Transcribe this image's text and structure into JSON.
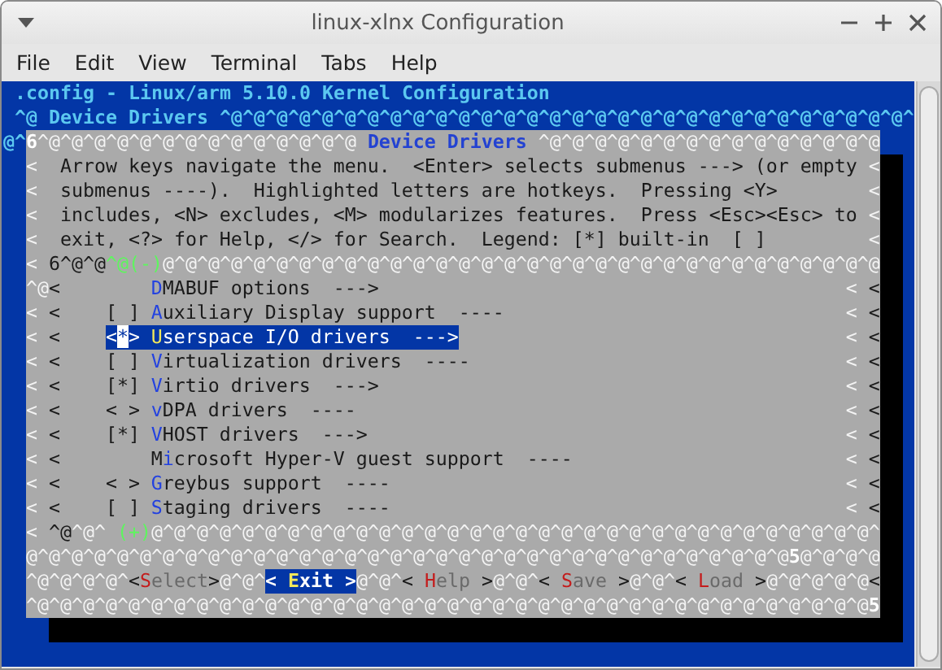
{
  "window": {
    "title": "linux-xlnx Configuration"
  },
  "menu_bar": [
    "File",
    "Edit",
    "View",
    "Terminal",
    "Tabs",
    "Help"
  ],
  "terminal": {
    "header": [
      ".config - Linux/arm 5.10.0 Kernel Configuration",
      "^@ Device Drivers ^@^@^@^@^@^@^@^@^@^@^@^@^@^@^@^@^@^@^@^@^@^@^@^@^@^@^@^@^@^@^"
    ],
    "left_margin": "@^",
    "dialog_rows": [
      {
        "kind": "line",
        "segments": [
          {
            "kind": "bright",
            "text": "6"
          },
          {
            "kind": "fill",
            "text": "^@^@^@^@^@^@^@^@^@^@^@^@^@^@"
          },
          {
            "kind": "title",
            "text": "Device Drivers"
          },
          {
            "kind": "fill",
            "text": "^@^@^@^@^@^@^@^@^@^@^@^@^@^@^@"
          }
        ]
      },
      {
        "kind": "help",
        "left": "<",
        "text": "Arrow keys navigate the menu.  <Enter> selects submenus ---> (or empty",
        "right": "<"
      },
      {
        "kind": "help",
        "left": "<",
        "text": "submenus ----).  Highlighted letters are hotkeys.  Pressing <Y>",
        "right": "<"
      },
      {
        "kind": "help",
        "left": "<",
        "text": "includes, <N> excludes, <M> modularizes features.  Press <Esc><Esc> to",
        "right": "<"
      },
      {
        "kind": "help",
        "left": "<",
        "text": "exit, <?> for Help, </> for Search.  Legend: [*] built-in  [ ]",
        "right": "<"
      },
      {
        "kind": "line",
        "segments": [
          {
            "kind": "fill",
            "text": "<"
          },
          {
            "kind": "dark",
            "text": " 6^@^@"
          },
          {
            "kind": "green",
            "text": "^@(-)"
          },
          {
            "kind": "fill",
            "text": "@^@^@^@^@^@^@^@^@^@^@^@^@^@^@^@^@^@^@^@^@^@^@^@^@^@^@^@^@^@^@^@"
          }
        ]
      },
      {
        "kind": "item",
        "edge": "^@",
        "mark": "<",
        "hotkey": "D",
        "rest": "MABUF options",
        "suffix": "--->",
        "right_edge": "<",
        "right_mark": "<",
        "selected": false
      },
      {
        "kind": "item",
        "edge": "<",
        "mark": "<",
        "bracket": "[ ]",
        "hotkey": "A",
        "rest": "uxiliary Display support",
        "suffix": "----",
        "right_edge": "<",
        "right_mark": "<",
        "selected": false
      },
      {
        "kind": "item",
        "edge": "<",
        "mark": "<",
        "bracket": "<*>",
        "hotkey": "U",
        "rest": "serspace I/O drivers",
        "suffix": "--->",
        "right_edge": "<",
        "right_mark": "<",
        "selected": true
      },
      {
        "kind": "item",
        "edge": "<",
        "mark": "<",
        "bracket": "[ ]",
        "hotkey": "V",
        "rest": "irtualization drivers",
        "suffix": "----",
        "right_edge": "<",
        "right_mark": "<",
        "selected": false
      },
      {
        "kind": "item",
        "edge": "<",
        "mark": "<",
        "bracket": "[*]",
        "hotkey": "V",
        "rest": "irtio drivers",
        "suffix": "--->",
        "right_edge": "<",
        "right_mark": "<",
        "selected": false
      },
      {
        "kind": "item",
        "edge": "<",
        "mark": "<",
        "bracket": "< >",
        "hotkey": "v",
        "rest": "DPA drivers",
        "suffix": "----",
        "right_edge": "<",
        "right_mark": "<",
        "selected": false
      },
      {
        "kind": "item",
        "edge": "<",
        "mark": "<",
        "bracket": "[*]",
        "hotkey": "V",
        "rest": "HOST drivers",
        "suffix": "--->",
        "right_edge": "<",
        "right_mark": "<",
        "selected": false
      },
      {
        "kind": "item",
        "edge": "<",
        "mark": "<",
        "pre": "M",
        "hotkey": "i",
        "rest": "crosoft Hyper-V guest support",
        "suffix": "----",
        "right_edge": "<",
        "right_mark": "<",
        "selected": false
      },
      {
        "kind": "item",
        "edge": "<",
        "mark": "<",
        "bracket": "< >",
        "hotkey": "G",
        "rest": "reybus support",
        "suffix": "----",
        "right_edge": "<",
        "right_mark": "<",
        "selected": false
      },
      {
        "kind": "item",
        "edge": "<",
        "mark": "<",
        "bracket": "[ ]",
        "hotkey": "S",
        "rest": "taging drivers",
        "suffix": "----",
        "right_edge": "<",
        "right_mark": "<",
        "selected": false
      },
      {
        "kind": "line",
        "segments": [
          {
            "kind": "fill",
            "text": "<"
          },
          {
            "kind": "dark",
            "text": " ^@"
          },
          {
            "kind": "fill",
            "text": "^@^ "
          },
          {
            "kind": "green",
            "text": "(+)"
          },
          {
            "kind": "fill",
            "text": "@^@^@^@^@^@^@^@^@^@^@^@^@^@^@^@^@^@^@^@^@^@^@^@^@^@^@^@^@^@^@^@^"
          }
        ]
      },
      {
        "kind": "line",
        "segments": [
          {
            "kind": "fill",
            "text": "@^@^@^@^@^@^@^@^@^@^@^@^@^@^@^@^@^@^@^@^@^@^@^@^@^@^@^@^@^@^@^@^@^@"
          },
          {
            "kind": "bright",
            "text": "5"
          },
          {
            "kind": "fill",
            "text": "@^@^@^@"
          }
        ]
      },
      {
        "kind": "line",
        "segments": [
          {
            "kind": "fill",
            "text": "^@^@^@^@^"
          },
          {
            "kind": "button",
            "open": "<",
            "hotkey": "S",
            "rest": "elect",
            "close": ">",
            "selected": false
          },
          {
            "kind": "fill",
            "text": "@^@^"
          },
          {
            "kind": "button",
            "open": "< ",
            "hotkey": "E",
            "rest": "xit",
            "close": " >",
            "selected": true
          },
          {
            "kind": "fill",
            "text": "@^@^"
          },
          {
            "kind": "button",
            "open": "< ",
            "hotkey": "H",
            "rest": "elp",
            "close": " >",
            "selected": false
          },
          {
            "kind": "fill",
            "text": "@^@^"
          },
          {
            "kind": "button",
            "open": "< ",
            "hotkey": "S",
            "rest": "ave",
            "close": " >",
            "selected": false
          },
          {
            "kind": "fill",
            "text": "@^@^"
          },
          {
            "kind": "button",
            "open": "< ",
            "hotkey": "L",
            "rest": "oad",
            "close": " >",
            "selected": false
          },
          {
            "kind": "fill",
            "text": "@^@^@^@^@"
          },
          {
            "kind": "dark",
            "text": "<"
          }
        ]
      },
      {
        "kind": "line",
        "segments": [
          {
            "kind": "fill",
            "text": "^@^@^@^@^@^@^@^@^@^@^@^@^@^@^@^@^@^@^@^@^@^@^@^@^@^@^@^@^@^@^@^@^@^@^@^@^@"
          },
          {
            "kind": "bright",
            "text": "5"
          }
        ]
      }
    ]
  }
}
